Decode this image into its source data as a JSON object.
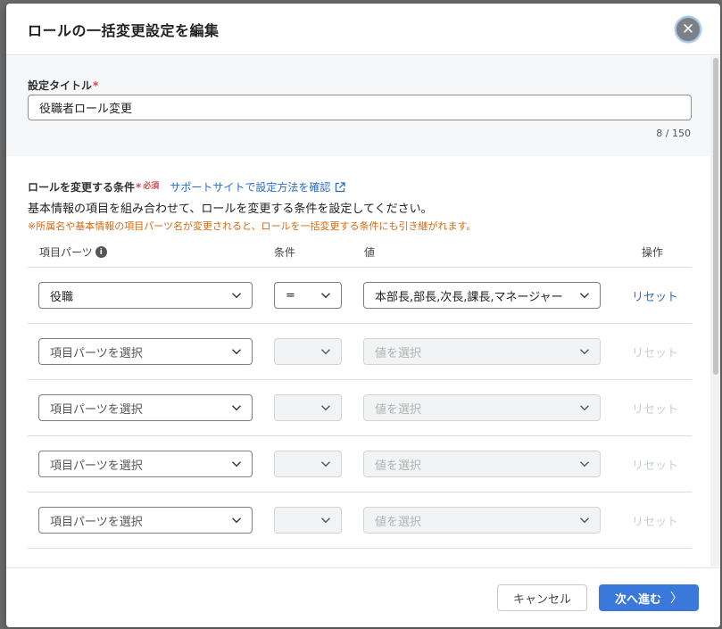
{
  "modal": {
    "title": "ロールの一括変更設定を編集",
    "close_label": "✕"
  },
  "title_section": {
    "label": "設定タイトル",
    "required_mark": "*",
    "value": "役職者ロール変更",
    "char_count": "8 / 150"
  },
  "conditions": {
    "label": "ロールを変更する条件",
    "required_mark": "*",
    "must_label": "必須",
    "help_link": "サポートサイトで設定方法を確認",
    "description": "基本情報の項目を組み合わせて、ロールを変更する条件を設定してください。",
    "warning": "※所属名や基本情報の項目パーツ名が変更されると、ロールを一括変更する条件にも引き継がれます。",
    "headers": {
      "item": "項目パーツ",
      "cond": "条件",
      "value": "値",
      "op": "操作"
    },
    "rows": [
      {
        "item": "役職",
        "cond": "=",
        "value": "本部長,部長,次長,課長,マネージャー",
        "reset": "リセット"
      },
      {
        "item": "項目パーツを選択",
        "cond": "",
        "value": "値を選択",
        "reset": "リセット"
      },
      {
        "item": "項目パーツを選択",
        "cond": "",
        "value": "値を選択",
        "reset": "リセット"
      },
      {
        "item": "項目パーツを選択",
        "cond": "",
        "value": "値を選択",
        "reset": "リセット"
      },
      {
        "item": "項目パーツを選択",
        "cond": "",
        "value": "値を選択",
        "reset": "リセット"
      }
    ]
  },
  "footer": {
    "cancel": "キャンセル",
    "next": "次へ進む",
    "next_arrow": "〉"
  },
  "colors": {
    "primary": "#3a79d9",
    "link": "#2b6cc4",
    "warning": "#d36b15",
    "required": "#e04545"
  }
}
